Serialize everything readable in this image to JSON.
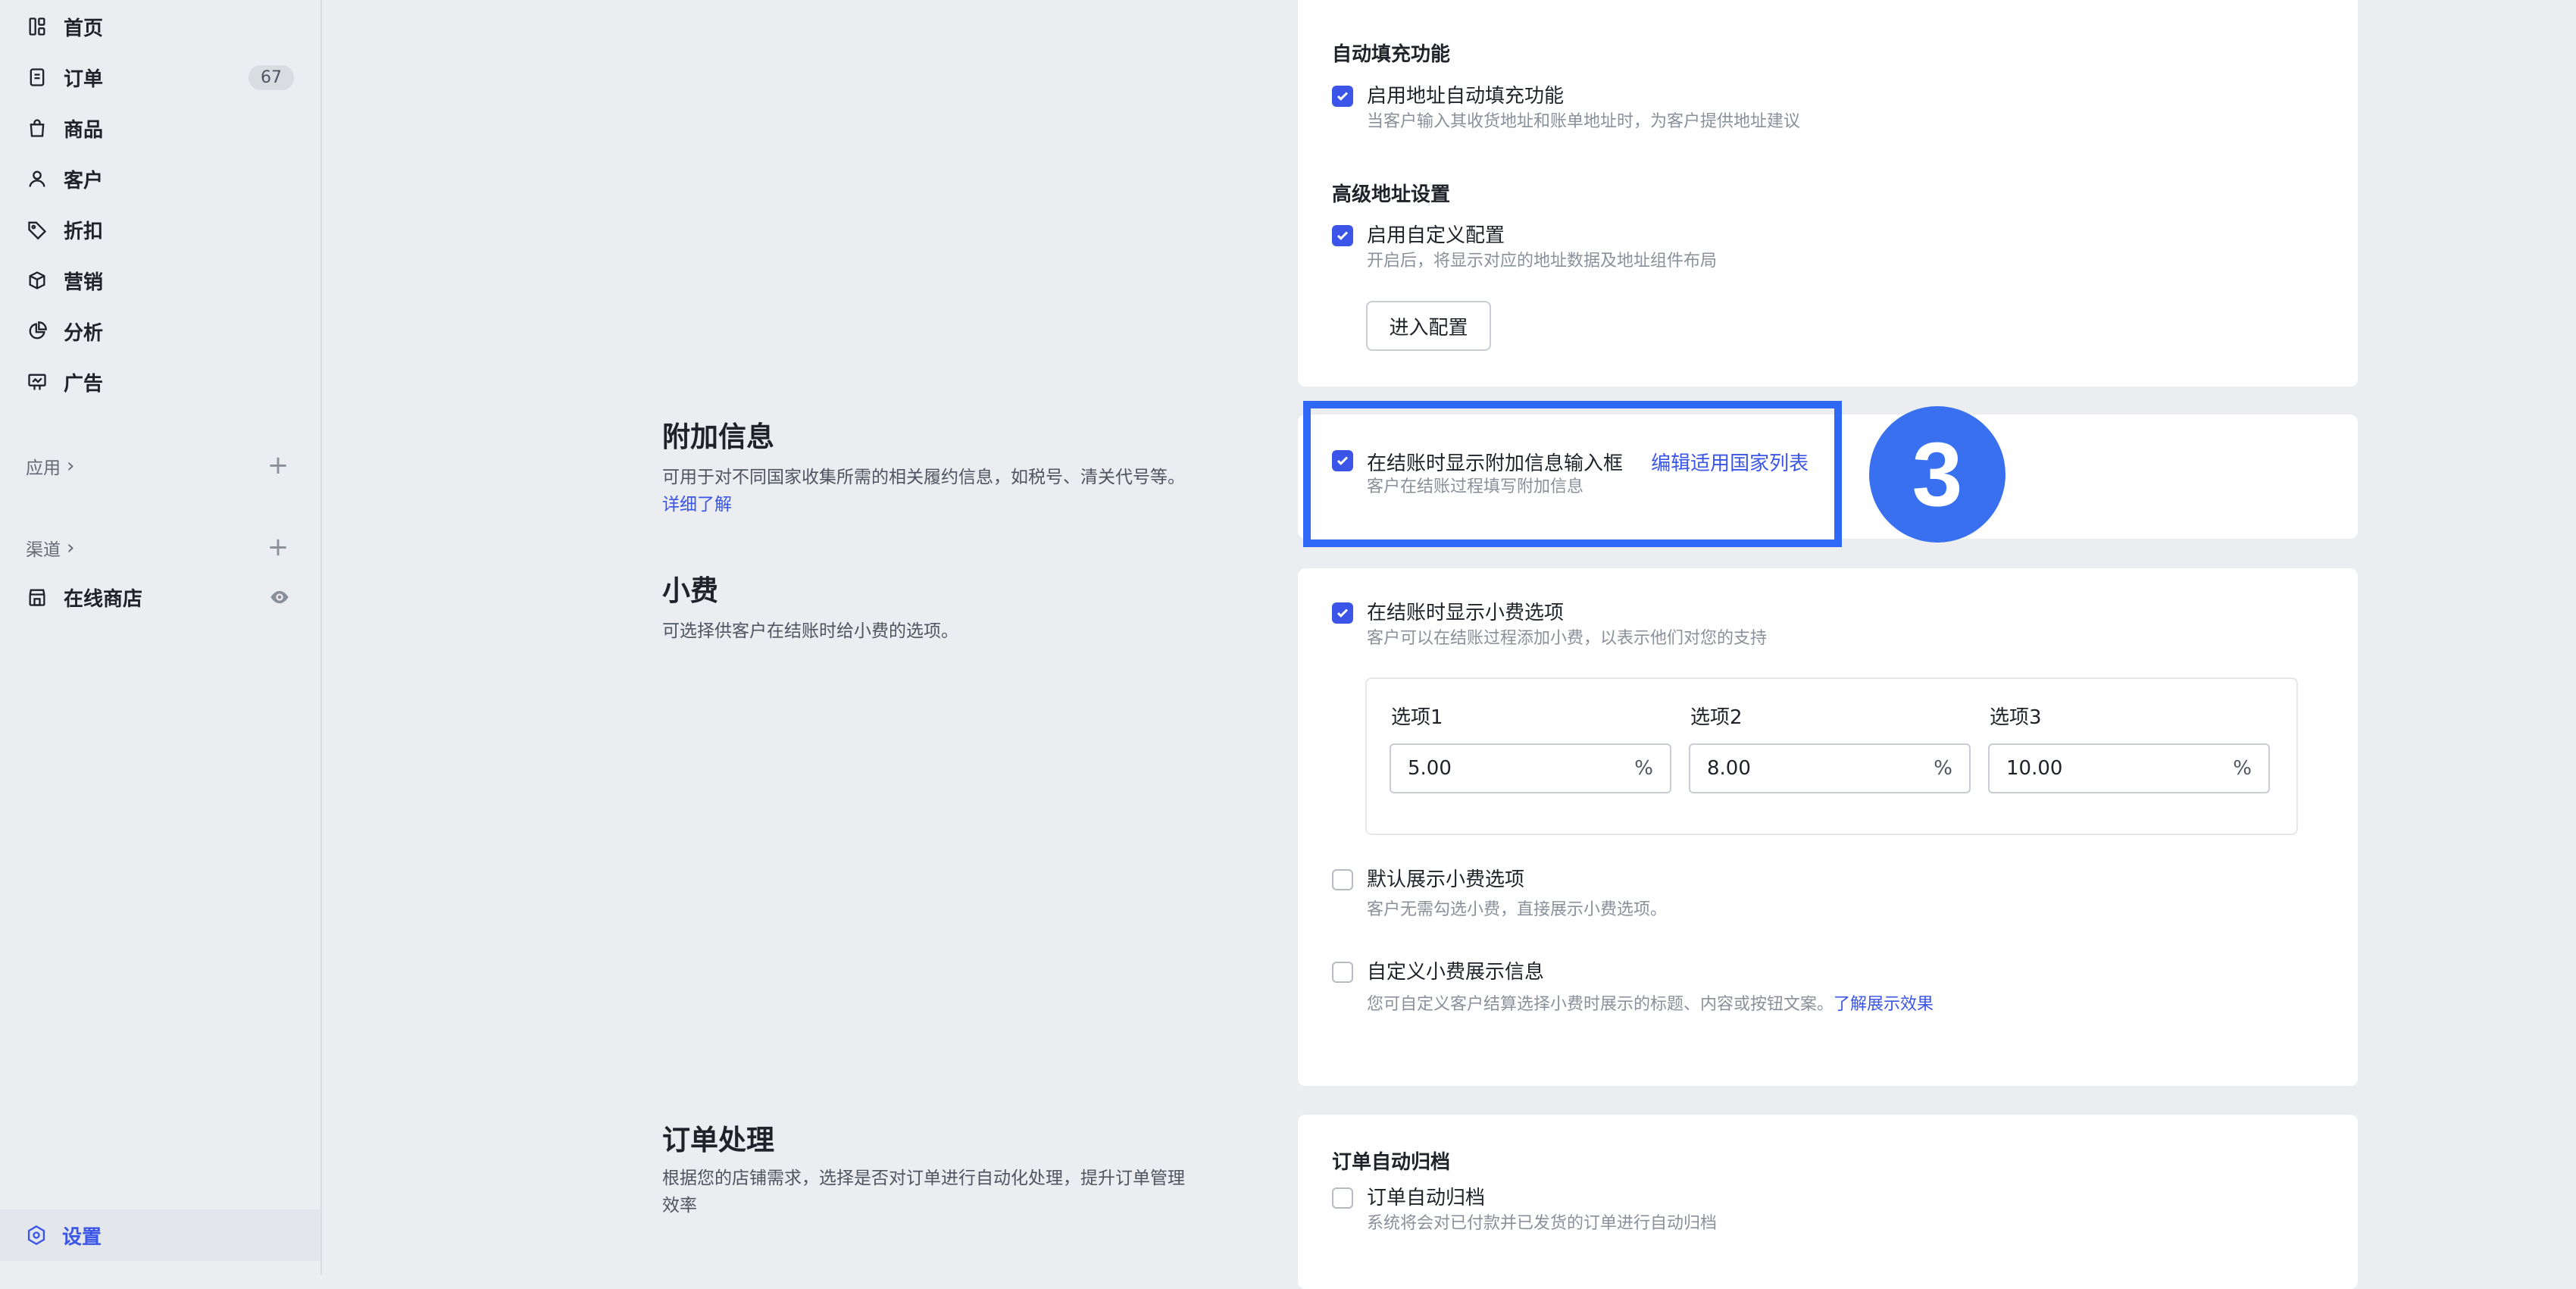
{
  "sidebar": {
    "items": [
      {
        "label": "首页",
        "icon": "home-icon"
      },
      {
        "label": "订单",
        "icon": "orders-icon",
        "badge": "67"
      },
      {
        "label": "商品",
        "icon": "shopping-bag-icon"
      },
      {
        "label": "客户",
        "icon": "user-icon"
      },
      {
        "label": "折扣",
        "icon": "tag-icon"
      },
      {
        "label": "营销",
        "icon": "cube-icon"
      },
      {
        "label": "分析",
        "icon": "pie-chart-icon"
      },
      {
        "label": "广告",
        "icon": "billboard-icon"
      }
    ],
    "apps_label": "应用",
    "channels_label": "渠道",
    "online_store_label": "在线商店",
    "settings_label": "设置"
  },
  "autofill": {
    "heading": "自动填充功能",
    "checkbox_label": "启用地址自动填充功能",
    "checkbox_hint": "当客户输入其收货地址和账单地址时，为客户提供地址建议",
    "checked": true
  },
  "advanced_address": {
    "heading": "高级地址设置",
    "checkbox_label": "启用自定义配置",
    "checkbox_hint": "开启后，将显示对应的地址数据及地址组件布局",
    "checked": true,
    "config_button": "进入配置"
  },
  "additional_info": {
    "title": "附加信息",
    "desc": "可用于对不同国家收集所需的相关履约信息，如税号、清关代号等。",
    "desc_link": "详细了解",
    "checkbox_label": "在结账时显示附加信息输入框",
    "checkbox_hint": "客户在结账过程填写附加信息",
    "checked": true,
    "edit_link": "编辑适用国家列表"
  },
  "step_badge": "3",
  "tips": {
    "title": "小费",
    "desc": "可选择供客户在结账时给小费的选项。",
    "show_checkbox_label": "在结账时显示小费选项",
    "show_checkbox_hint": "客户可以在结账过程添加小费，以表示他们对您的支持",
    "show_checked": true,
    "options": [
      {
        "label": "选项1",
        "value": "5.00",
        "unit": "%"
      },
      {
        "label": "选项2",
        "value": "8.00",
        "unit": "%"
      },
      {
        "label": "选项3",
        "value": "10.00",
        "unit": "%"
      }
    ],
    "default_checkbox_label": "默认展示小费选项",
    "default_checkbox_hint": "客户无需勾选小费，直接展示小费选项。",
    "default_checked": false,
    "custom_checkbox_label": "自定义小费展示信息",
    "custom_checkbox_hint": "您可自定义客户结算选择小费时展示的标题、内容或按钮文案。",
    "custom_checkbox_link": "了解展示效果",
    "custom_checked": false
  },
  "order_processing": {
    "title": "订单处理",
    "desc": "根据您的店铺需求，选择是否对订单进行自动化处理，提升订单管理效率",
    "card_heading": "订单自动归档",
    "checkbox_label": "订单自动归档",
    "checkbox_hint": "系统将会对已付款并已发货的订单进行自动归档",
    "checked": false
  },
  "colors": {
    "accent": "#3a55e8",
    "highlight": "#2f67f6"
  }
}
